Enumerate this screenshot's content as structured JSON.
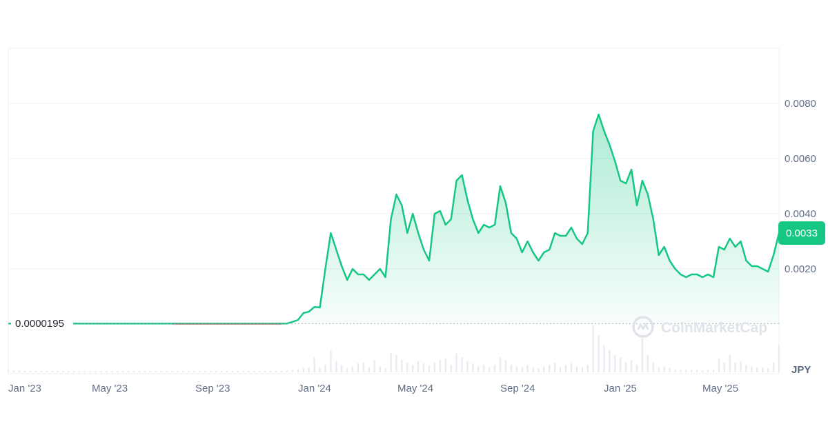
{
  "chart_data": {
    "type": "area",
    "x_ticks": [
      "Jan '23",
      "May '23",
      "Sep '23",
      "Jan '24",
      "May '24",
      "Sep '24",
      "Jan '25",
      "May '25"
    ],
    "y_ticks": [
      "0.0080",
      "0.0060",
      "0.0040",
      "0.0020"
    ],
    "ylim": [
      0,
      0.01
    ],
    "baseline_value": 1.95e-05,
    "baseline_label": "0.0000195",
    "current_price": "0.0033",
    "currency": "JPY",
    "grid": true,
    "colors": {
      "up": "#16c784",
      "down": "#ea3943",
      "axis": "#616e85",
      "grid": "#eff2f5"
    },
    "series": [
      {
        "values": [
          2e-05,
          2e-05,
          2e-05,
          2e-05,
          2e-05,
          2e-05,
          2e-05,
          2e-05,
          2e-05,
          2e-05,
          2e-05,
          2e-05,
          2e-05,
          2e-05,
          2e-05,
          2e-05,
          2e-05,
          2e-05,
          2e-05,
          2e-05,
          2e-05,
          2e-05,
          2e-05,
          2e-05,
          2e-05,
          2e-05,
          2e-05,
          2e-05,
          2e-05,
          2e-05,
          2e-05,
          2e-05,
          2e-05,
          2e-05,
          2e-05,
          2e-05,
          2e-05,
          2e-05,
          2e-05,
          2e-05,
          2e-05,
          2e-05,
          2e-05,
          2e-05,
          2e-05,
          2e-05,
          2e-05,
          2e-05,
          2e-05,
          2e-05,
          2e-05,
          2e-05,
          8e-05,
          0.00015,
          0.0004,
          0.00045,
          0.00062,
          0.0006,
          0.002,
          0.0033,
          0.0027,
          0.0021,
          0.0016,
          0.002,
          0.0018,
          0.0018,
          0.0016,
          0.0018,
          0.002,
          0.0017,
          0.0038,
          0.0047,
          0.0043,
          0.0033,
          0.004,
          0.0033,
          0.0027,
          0.0023,
          0.004,
          0.0041,
          0.0036,
          0.0038,
          0.0052,
          0.0054,
          0.0045,
          0.0038,
          0.0033,
          0.0036,
          0.0035,
          0.0036,
          0.005,
          0.0044,
          0.0033,
          0.0031,
          0.0026,
          0.003,
          0.0026,
          0.0023,
          0.0026,
          0.0027,
          0.0033,
          0.0032,
          0.0032,
          0.0035,
          0.0031,
          0.0029,
          0.0033,
          0.007,
          0.0076,
          0.007,
          0.0065,
          0.0059,
          0.0052,
          0.0051,
          0.0056,
          0.0043,
          0.0052,
          0.0047,
          0.0038,
          0.0025,
          0.0028,
          0.0023,
          0.002,
          0.0018,
          0.0017,
          0.0018,
          0.0018,
          0.0017,
          0.0018,
          0.0017,
          0.0028,
          0.0027,
          0.0031,
          0.0028,
          0.003,
          0.0023,
          0.0021,
          0.0021,
          0.002,
          0.0019,
          0.0025,
          0.0033
        ]
      }
    ],
    "volume": [
      0.05,
      0.04,
      0.04,
      0.03,
      0.03,
      0.03,
      0.03,
      0.03,
      0.03,
      0.03,
      0.03,
      0.03,
      0.03,
      0.03,
      0.03,
      0.03,
      0.03,
      0.03,
      0.03,
      0.03,
      0.03,
      0.03,
      0.03,
      0.03,
      0.03,
      0.03,
      0.03,
      0.03,
      0.03,
      0.03,
      0.03,
      0.03,
      0.03,
      0.03,
      0.03,
      0.03,
      0.03,
      0.03,
      0.03,
      0.03,
      0.03,
      0.03,
      0.03,
      0.03,
      0.03,
      0.03,
      0.03,
      0.03,
      0.03,
      0.03,
      0.03,
      0.04,
      0.05,
      0.06,
      0.08,
      0.1,
      0.3,
      0.1,
      0.15,
      0.45,
      0.22,
      0.15,
      0.08,
      0.12,
      0.18,
      0.2,
      0.1,
      0.25,
      0.12,
      0.08,
      0.4,
      0.35,
      0.25,
      0.2,
      0.15,
      0.22,
      0.18,
      0.14,
      0.2,
      0.25,
      0.28,
      0.15,
      0.38,
      0.3,
      0.22,
      0.18,
      0.12,
      0.15,
      0.1,
      0.15,
      0.3,
      0.25,
      0.15,
      0.12,
      0.1,
      0.15,
      0.1,
      0.08,
      0.12,
      0.15,
      0.2,
      0.1,
      0.15,
      0.18,
      0.12,
      0.1,
      0.15,
      0.95,
      0.75,
      0.55,
      0.45,
      0.35,
      0.3,
      0.2,
      0.25,
      0.15,
      0.7,
      0.35,
      0.2,
      0.1,
      0.12,
      0.08,
      0.06,
      0.05,
      0.06,
      0.05,
      0.05,
      0.04,
      0.05,
      0.05,
      0.28,
      0.2,
      0.35,
      0.2,
      0.22,
      0.15,
      0.12,
      0.1,
      0.1,
      0.08,
      0.2,
      0.55
    ]
  },
  "watermark": {
    "text": "CoinMarketCap",
    "icon": "coinmarketcap-logo-icon"
  }
}
